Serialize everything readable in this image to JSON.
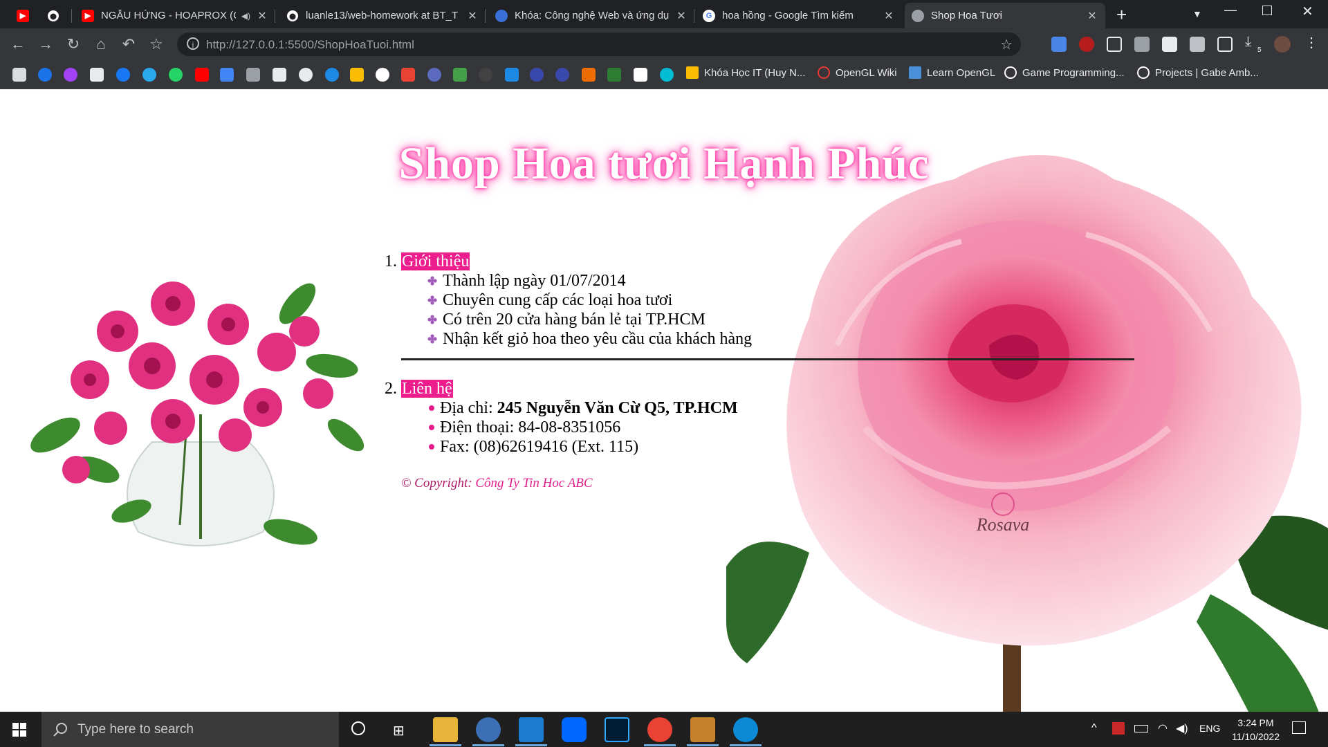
{
  "browser": {
    "tabs": [
      {
        "title": "",
        "icon": "youtube-icon",
        "color": "#ff0000"
      },
      {
        "title": "",
        "icon": "github-icon",
        "color": "#ffffff"
      },
      {
        "title": "NGẪU HỨNG - HOAPROX (C",
        "icon": "youtube-icon",
        "color": "#ff0000",
        "audio": true
      },
      {
        "title": "luanle13/web-homework at BT_T",
        "icon": "github-icon",
        "color": "#ffffff"
      },
      {
        "title": "Khóa: Công nghệ Web và ứng dụ",
        "icon": "course-icon",
        "color": "#3b6fd8"
      },
      {
        "title": "hoa hồng - Google Tìm kiếm",
        "icon": "google-icon",
        "color": "#ffffff"
      },
      {
        "title": "Shop Hoa Tươi",
        "icon": "globe-icon",
        "color": "#9aa0a6",
        "active": true
      }
    ],
    "url": "http://127.0.0.1:5500/ShopHoaTuoi.html",
    "url_host": "127.0.0.1",
    "bookmarks": [
      {
        "label": "Khóa Học IT (Huy N...",
        "color": "#fbbc04"
      },
      {
        "label": "OpenGL Wiki",
        "color": "#e53935"
      },
      {
        "label": "Learn OpenGL",
        "color": "#4a90d9"
      },
      {
        "label": "Game Programming...",
        "color": "#ffffff"
      },
      {
        "label": "Projects | Gabe Amb...",
        "color": "#ffffff"
      }
    ],
    "download_count": "5"
  },
  "page": {
    "title": "Shop Hoa tươi Hạnh Phúc",
    "sections": [
      {
        "heading": "Giới thiệu",
        "items": [
          "Thành lập ngày 01/07/2014",
          "Chuyên cung cấp các loại hoa tươi",
          "Có trên 20 cửa hàng bán lẻ tại TP.HCM",
          "Nhận kết giỏ hoa theo yêu cầu của khách hàng"
        ]
      },
      {
        "heading": "Liên hệ",
        "address_label": "Địa chỉ: ",
        "address_value": "245 Nguyễn Văn Cừ Q5, TP.HCM",
        "phone": "Điện thoại: 84-08-8351056",
        "fax": "Fax: (08)62619416 (Ext. 115)"
      }
    ],
    "copyright_prefix": "© Copyright: ",
    "copyright_company": "Công Ty Tin Hoc ABC",
    "watermark": "Rosava",
    "colors": {
      "heading_bg": "#ec1d8c",
      "title_glow": "#ff2fa3",
      "copyright": "#ad1764"
    }
  },
  "taskbar": {
    "search_placeholder": "Type here to search",
    "language": "ENG",
    "time": "3:24 PM",
    "date": "11/10/2022"
  }
}
